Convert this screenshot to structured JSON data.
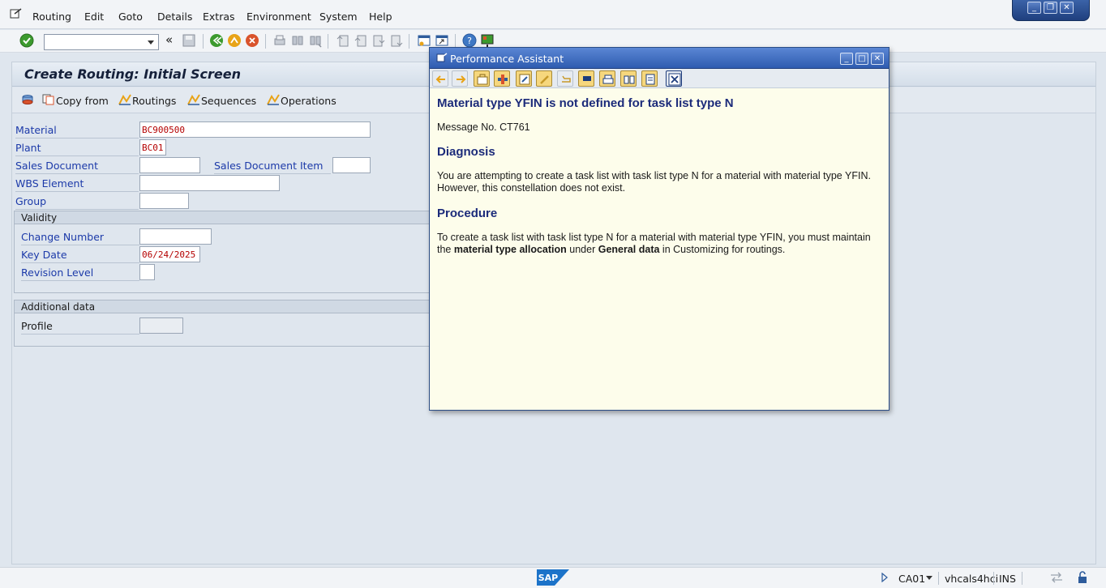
{
  "menu": {
    "items": [
      "Routing",
      "Edit",
      "Goto",
      "Details",
      "Extras",
      "Environment",
      "System",
      "Help"
    ],
    "mnemonics": [
      "R",
      "E",
      "G",
      "D",
      "x",
      "n",
      "y",
      "H"
    ]
  },
  "toolbar": {
    "command_value": "",
    "icons": [
      "enter-icon",
      "back-double-icon",
      "save-icon",
      "back-icon",
      "exit-icon",
      "cancel-icon",
      "print-icon",
      "find-icon",
      "find-next-icon",
      "first-page-icon",
      "prev-page-icon",
      "next-page-icon",
      "last-page-icon",
      "new-session-icon",
      "shortcut-icon",
      "help-icon",
      "customize-layout-icon"
    ]
  },
  "page": {
    "title": "Create Routing: Initial Screen",
    "app_toolbar": {
      "copy_from": "Copy from",
      "routings": "Routings",
      "sequences": "Sequences",
      "operations": "Operations"
    }
  },
  "form": {
    "material_label": "Material",
    "material_value": "BC900500",
    "plant_label": "Plant",
    "plant_value": "BC01",
    "sales_doc_label": "Sales Document",
    "sales_doc_value": "",
    "sales_item_label": "Sales Document Item",
    "sales_item_value": "",
    "wbs_label": "WBS Element",
    "wbs_value": "",
    "group_label": "Group",
    "group_value": "",
    "validity": {
      "title": "Validity",
      "change_number_label": "Change Number",
      "change_number_value": "",
      "key_date_label": "Key Date",
      "key_date_value": "06/24/2025",
      "revision_label": "Revision Level",
      "revision_value": ""
    },
    "additional": {
      "title": "Additional data",
      "profile_label": "Profile",
      "profile_value": ""
    }
  },
  "popup": {
    "title": "Performance Assistant",
    "heading": "Material type YFIN is not defined for task list type N",
    "message_no": "Message No. CT761",
    "diagnosis_title": "Diagnosis",
    "diagnosis_text": "You are attempting to create a task list with task list type N for a material with material type YFIN. However, this constellation does not exist.",
    "procedure_title": "Procedure",
    "procedure_prefix": "To create a task list with task list type N for a material with material type YFIN, you must maintain the ",
    "procedure_bold1": "material type allocation",
    "procedure_mid": " under ",
    "procedure_bold2": "General data",
    "procedure_suffix": " in Customizing for routings."
  },
  "status": {
    "transaction": "CA01",
    "server": "vhcals4hci",
    "mode": "INS"
  },
  "colors": {
    "label_blue": "#1c3aa9",
    "value_red": "#b40000",
    "popup_title": "#2f5cb0",
    "popup_bg": "#fdfdeb",
    "heading_navy": "#1c2b7a"
  }
}
